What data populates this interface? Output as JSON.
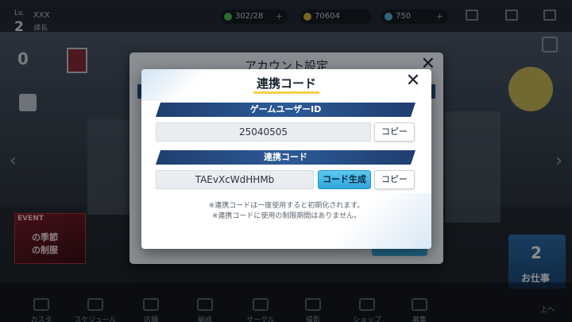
{
  "hud": {
    "level_label": "Lv.",
    "level_value": "2",
    "player_name": "XXX",
    "player_sub": "課長",
    "stamina": "302/28",
    "coins": "70604",
    "gems": "750",
    "plus": "+"
  },
  "side": {
    "zero": "0",
    "event_label": "EVENT",
    "event_title": "の季節",
    "event_sub": "の制服",
    "job_label": "お仕事",
    "job_number": "2"
  },
  "bottom_nav": {
    "items": [
      "カスタ",
      "スケジュール",
      "店舗",
      "編成",
      "サークル",
      "撮影",
      "ショップ",
      "募集"
    ],
    "up_label": "上へ"
  },
  "back_dialog": {
    "title": "アカウント設定",
    "close": "✕"
  },
  "dialog": {
    "title": "連携コード",
    "close": "✕",
    "user_id_header": "ゲームユーザーID",
    "user_id_value": "25040505",
    "copy_label": "コピー",
    "link_code_header": "連携コード",
    "link_code_value": "TAEvXcWdHHMb",
    "generate_label": "コード生成",
    "copy_label_2": "コピー",
    "note_1": "※連携コードは一度使用すると初期化されます。",
    "note_2": "※連携コードに使用の制限期間はありません。"
  },
  "colors": {
    "section_bar": "#274f84",
    "accent_blue": "#2ea6dc",
    "title_underline": "#f0d24a"
  }
}
